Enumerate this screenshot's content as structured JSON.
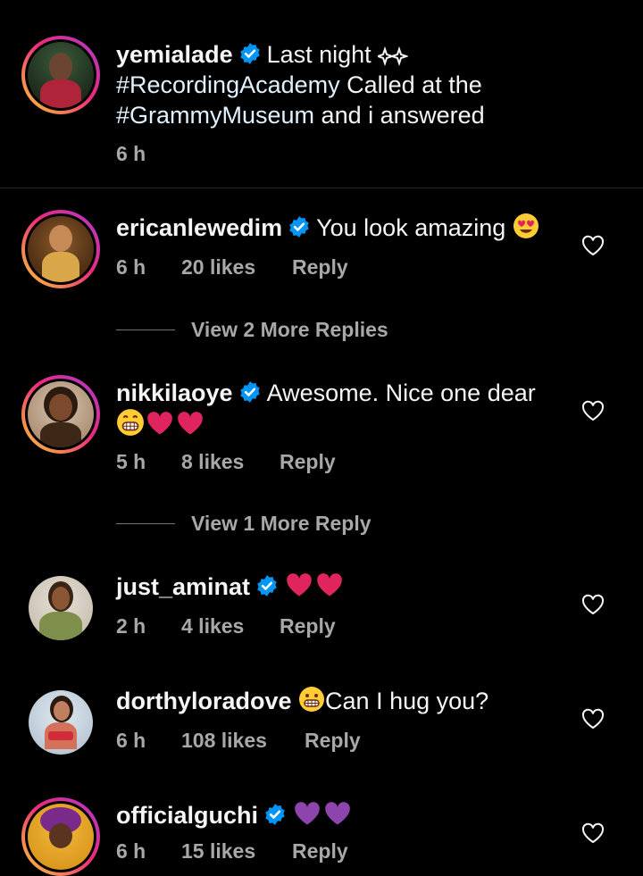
{
  "post": {
    "username": "yemialade",
    "caption_line1": "Last night",
    "caption_hashtag1": "#RecordingAcademy",
    "caption_mid": " Called at the",
    "caption_hashtag2": "#GrammyMuseum",
    "caption_end": " and i answered",
    "time": "6 h"
  },
  "comments": [
    {
      "username": "ericanlewedim",
      "text": "You look amazing",
      "time": "6 h",
      "likes": "20 likes",
      "reply": "Reply",
      "view_more": "View 2 More Replies"
    },
    {
      "username": "nikkilaoye",
      "text": "Awesome. Nice one dear",
      "time": "5 h",
      "likes": "8 likes",
      "reply": "Reply",
      "view_more": "View 1 More Reply"
    },
    {
      "username": "just_aminat",
      "text": "",
      "time": "2 h",
      "likes": "4 likes",
      "reply": "Reply"
    },
    {
      "username": "dorthyloradove",
      "text": "Can I hug you?",
      "time": "6 h",
      "likes": "108 likes",
      "reply": "Reply"
    },
    {
      "username": "officialguchi",
      "text": "",
      "time": "6 h",
      "likes": "15 likes",
      "reply": "Reply"
    }
  ],
  "colors": {
    "background": "#000000",
    "verified_blue": "#0095f6",
    "muted_text": "#a8a8a8",
    "heart_red": "#e0245e",
    "purple_heart": "#8e44ad"
  }
}
